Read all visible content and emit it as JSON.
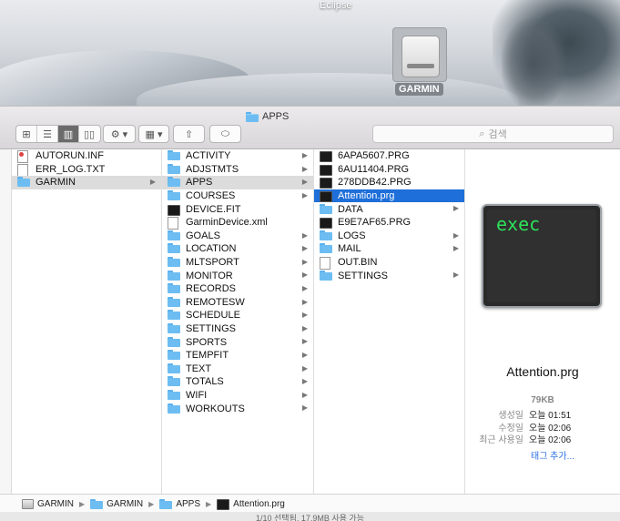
{
  "desktop": {
    "app_label": "Eclipse",
    "drive_label": "GARMIN"
  },
  "window": {
    "title": "APPS",
    "search_placeholder": "검색"
  },
  "column1": [
    {
      "label": "AUTORUN.INF",
      "type": "doc-red"
    },
    {
      "label": "ERR_LOG.TXT",
      "type": "doc"
    },
    {
      "label": "GARMIN",
      "type": "folder",
      "selected": "gray",
      "has_children": true
    }
  ],
  "column2": [
    {
      "label": "ACTIVITY",
      "type": "folder",
      "has_children": true
    },
    {
      "label": "ADJSTMTS",
      "type": "folder",
      "has_children": true
    },
    {
      "label": "APPS",
      "type": "folder",
      "selected": "gray",
      "has_children": true
    },
    {
      "label": "COURSES",
      "type": "folder",
      "has_children": true
    },
    {
      "label": "DEVICE.FIT",
      "type": "exec"
    },
    {
      "label": "GarminDevice.xml",
      "type": "doc"
    },
    {
      "label": "GOALS",
      "type": "folder",
      "has_children": true
    },
    {
      "label": "LOCATION",
      "type": "folder",
      "has_children": true
    },
    {
      "label": "MLTSPORT",
      "type": "folder",
      "has_children": true
    },
    {
      "label": "MONITOR",
      "type": "folder",
      "has_children": true
    },
    {
      "label": "RECORDS",
      "type": "folder",
      "has_children": true
    },
    {
      "label": "REMOTESW",
      "type": "folder",
      "has_children": true
    },
    {
      "label": "SCHEDULE",
      "type": "folder",
      "has_children": true
    },
    {
      "label": "SETTINGS",
      "type": "folder",
      "has_children": true
    },
    {
      "label": "SPORTS",
      "type": "folder",
      "has_children": true
    },
    {
      "label": "TEMPFIT",
      "type": "folder",
      "has_children": true
    },
    {
      "label": "TEXT",
      "type": "folder",
      "has_children": true
    },
    {
      "label": "TOTALS",
      "type": "folder",
      "has_children": true
    },
    {
      "label": "WIFI",
      "type": "folder",
      "has_children": true
    },
    {
      "label": "WORKOUTS",
      "type": "folder",
      "has_children": true
    }
  ],
  "column3": [
    {
      "label": "6APA5607.PRG",
      "type": "exec"
    },
    {
      "label": "6AU11404.PRG",
      "type": "exec"
    },
    {
      "label": "278DDB42.PRG",
      "type": "exec"
    },
    {
      "label": "Attention.prg",
      "type": "exec",
      "selected": "blue"
    },
    {
      "label": "DATA",
      "type": "folder",
      "has_children": true
    },
    {
      "label": "E9E7AF65.PRG",
      "type": "exec"
    },
    {
      "label": "LOGS",
      "type": "folder",
      "has_children": true
    },
    {
      "label": "MAIL",
      "type": "folder",
      "has_children": true
    },
    {
      "label": "OUT.BIN",
      "type": "doc"
    },
    {
      "label": "SETTINGS",
      "type": "folder",
      "has_children": true
    }
  ],
  "preview": {
    "icon_text": "exec",
    "filename": "Attention.prg",
    "size": "79KB",
    "meta": [
      {
        "key": "생성일",
        "value": "오늘 01:51"
      },
      {
        "key": "수정일",
        "value": "오늘 02:06"
      },
      {
        "key": "최근 사용일",
        "value": "오늘 02:06"
      }
    ],
    "add_tags": "태그 추가..."
  },
  "pathbar": [
    "GARMIN",
    "GARMIN",
    "APPS",
    "Attention.prg"
  ],
  "status": "1/10 선택됨, 17.9MB 사용 가능",
  "colors": {
    "selection_blue": "#1e6fd9",
    "folder_blue": "#6dbdf2",
    "terminal_green": "#2de15a"
  }
}
